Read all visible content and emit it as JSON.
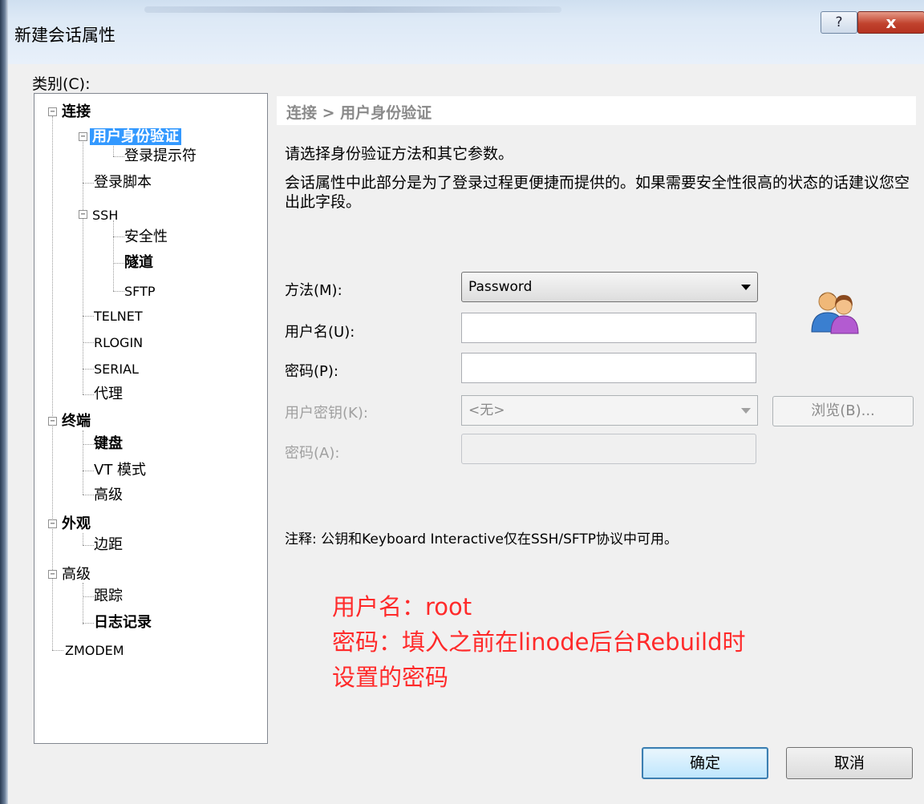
{
  "window": {
    "title": "新建会话属性",
    "help_glyph": "?",
    "close_glyph": "x"
  },
  "category_label": "类别(C):",
  "tree": {
    "items": [
      {
        "label": "连接",
        "expander": "−"
      },
      {
        "label": "用户身份验证",
        "expander": "−"
      },
      {
        "label": "登录提示符"
      },
      {
        "label": "登录脚本"
      },
      {
        "label": "SSH",
        "expander": "−"
      },
      {
        "label": "安全性"
      },
      {
        "label": "隧道"
      },
      {
        "label": "SFTP"
      },
      {
        "label": "TELNET"
      },
      {
        "label": "RLOGIN"
      },
      {
        "label": "SERIAL"
      },
      {
        "label": "代理"
      },
      {
        "label": "终端",
        "expander": "−"
      },
      {
        "label": "键盘"
      },
      {
        "label": "VT 模式"
      },
      {
        "label": "高级"
      },
      {
        "label": "外观",
        "expander": "−"
      },
      {
        "label": "边距"
      },
      {
        "label": "高级",
        "expander": "−"
      },
      {
        "label": "跟踪"
      },
      {
        "label": "日志记录"
      },
      {
        "label": "ZMODEM"
      }
    ],
    "selected": "用户身份验证"
  },
  "panel": {
    "header": "连接 > 用户身份验证",
    "description_1": "请选择身份验证方法和其它参数。",
    "description_2": "会话属性中此部分是为了登录过程更便捷而提供的。如果需要安全性很高的状态的话建议您空出此字段。"
  },
  "form": {
    "method_label": "方法(M):",
    "method_value": "Password",
    "username_label": "用户名(U):",
    "username_value": "",
    "password_label": "密码(P):",
    "password_value": "",
    "userkey_label": "用户密钥(K):",
    "userkey_value": "<无>",
    "browse_label": "浏览(B)...",
    "passphrase_label": "密码(A):",
    "passphrase_value": ""
  },
  "note": "注释: 公钥和Keyboard Interactive仅在SSH/SFTP协议中可用。",
  "annotation": {
    "line1": "用户名：root",
    "line2": "密码：填入之前在linode后台Rebuild时",
    "line3": "设置的密码"
  },
  "buttons": {
    "ok": "确定",
    "cancel": "取消"
  },
  "colors": {
    "selection": "#3399ff",
    "annotation": "#ff2a2a",
    "disabled_text": "#a0a0a0"
  }
}
